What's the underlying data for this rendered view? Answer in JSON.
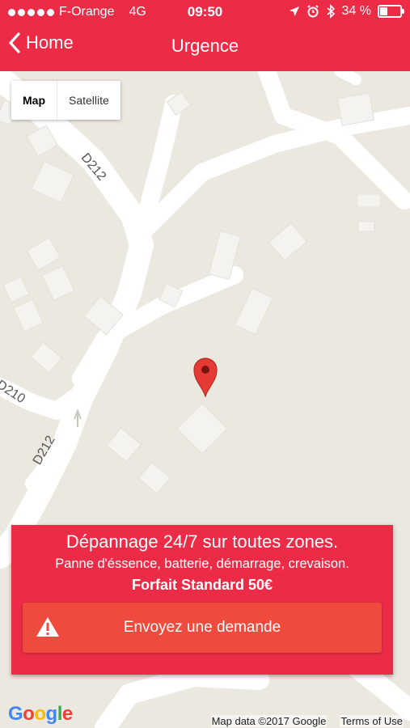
{
  "status": {
    "carrier": "F-Orange",
    "network": "4G",
    "time": "09:50",
    "battery": "34 %",
    "battery_level": 0.34,
    "icons": [
      "location-arrow-icon",
      "alarm-icon",
      "bluetooth-icon"
    ]
  },
  "nav": {
    "back_label": "Home",
    "title": "Urgence"
  },
  "map": {
    "type_map": "Map",
    "type_satellite": "Satellite",
    "active_type": "Map",
    "road_labels": [
      "D212",
      "D210",
      "D212"
    ],
    "google_logo": "Google",
    "map_data": "Map data ©2017 Google",
    "terms": "Terms of Use"
  },
  "card": {
    "headline": "Dépannage 24/7 sur toutes zones.",
    "services": "Panne d'éssence, batterie, démarrage, crevaison.",
    "price": "Forfait Standard 50€",
    "cta_label": "Envoyez une demande"
  },
  "colors": {
    "brand_red": "#ec2c47",
    "cta_red": "#ee4a3d",
    "map_bg": "#ebe8df"
  }
}
